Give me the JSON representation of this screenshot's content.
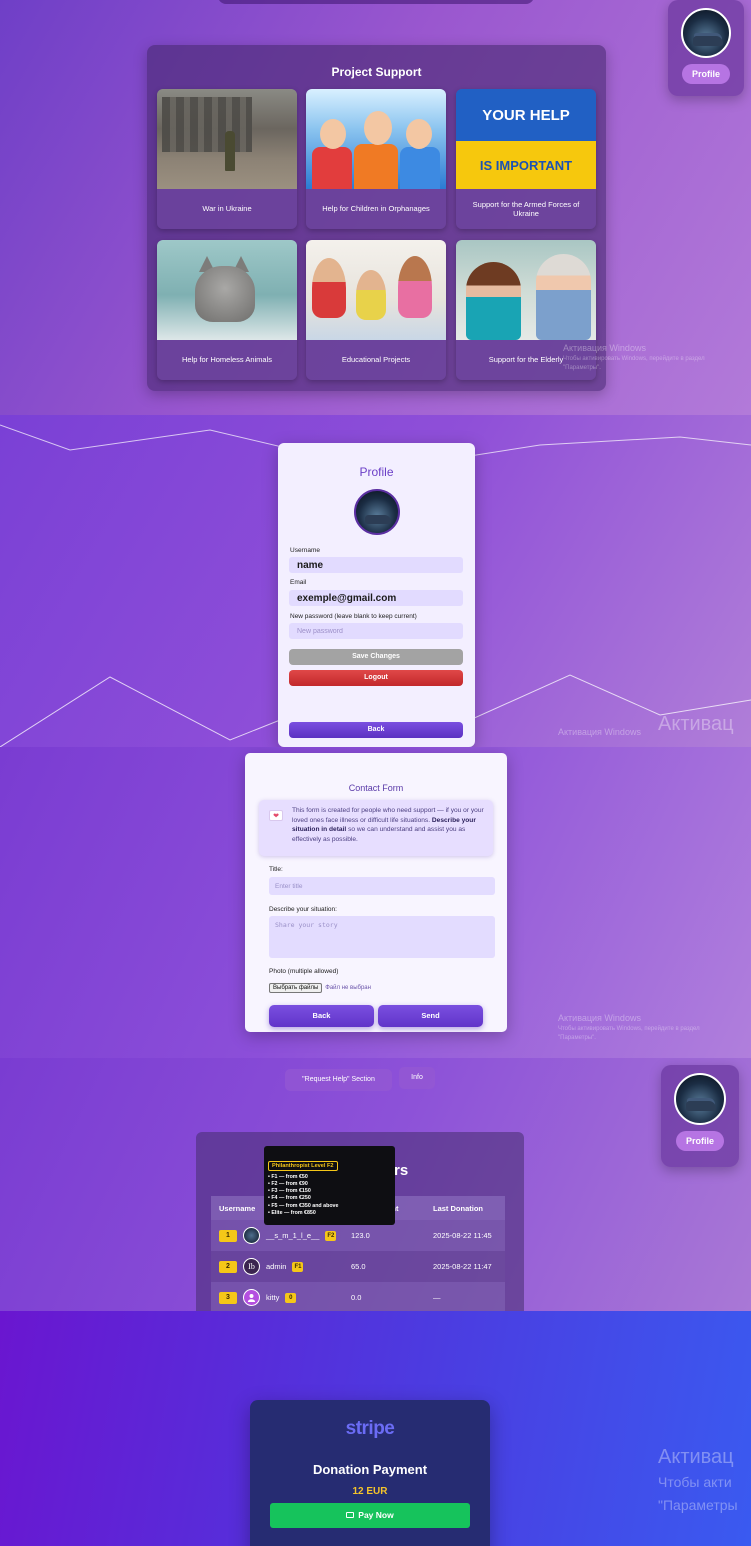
{
  "profile_widget": {
    "button_label": "Profile"
  },
  "project_support": {
    "title": "Project Support",
    "cards": [
      {
        "label": "War in Ukraine"
      },
      {
        "label": "Help for Children in Orphanages"
      },
      {
        "label": "Support for the Armed Forces of Ukraine",
        "image_text_1": "YOUR HELP",
        "image_text_2": "IS IMPORTANT"
      },
      {
        "label": "Help for Homeless Animals"
      },
      {
        "label": "Educational Projects"
      },
      {
        "label": "Support for the Elderly"
      }
    ]
  },
  "watermarks": {
    "activation_small": "Активация Windows",
    "activation_hint_1": "Чтобы активировать Windows, перейдите в раздел",
    "activation_hint_2": "\"Параметры\".",
    "activation_large": "Активац",
    "activation_large_hint_1": "Чтобы акти",
    "activation_large_hint_2": "\"Параметры"
  },
  "profile_form": {
    "title": "Profile",
    "username_label": "Username",
    "username_value": "name",
    "email_label": "Email",
    "email_value": "exemple@gmail.com",
    "password_label": "New password (leave blank to keep current)",
    "password_placeholder": "New password",
    "save_label": "Save Changes",
    "logout_label": "Logout",
    "back_label": "Back"
  },
  "contact_form": {
    "title": "Contact Form",
    "info_text_1": "This form is created for people who need support — if you or your loved ones face illness or difficult life situations.",
    "info_text_bold": "Describe your situation in detail",
    "info_text_2": "so we can understand and assist you as effectively as possible.",
    "title_label": "Title:",
    "title_placeholder": "Enter title",
    "describe_label": "Describe your situation:",
    "describe_placeholder": "Share your story",
    "photo_label": "Photo (multiple allowed)",
    "file_button": "Выбрать файлы",
    "file_status": "Файл не выбран",
    "back_label": "Back",
    "send_label": "Send"
  },
  "top_donators": {
    "request_help_button": "\"Request Help\" Section",
    "info_button": "Info",
    "title": "Top Donators",
    "columns": [
      "Username",
      "Total Amount",
      "Last Donation"
    ],
    "rows": [
      {
        "rank": "1",
        "username": "__s_m_1_l_e__",
        "level": "F2",
        "amount": "123.0",
        "last": "2025-08-22 11:45",
        "avatar": "car"
      },
      {
        "rank": "2",
        "username": "admin",
        "level": "F1",
        "amount": "65.0",
        "last": "2025-08-22 11:47",
        "avatar": "Ib"
      },
      {
        "rank": "3",
        "username": "kitty",
        "level": "0",
        "amount": "0.0",
        "last": "—",
        "avatar": "user"
      }
    ],
    "tooltip": {
      "title": "Philanthropist Level F2",
      "items": [
        "• F1 — from €50",
        "• F2 — from €90",
        "• F3 — from €150",
        "• F4 — from €250",
        "• F5 — from €350 and above",
        "• Elite — from €850"
      ]
    }
  },
  "stripe": {
    "logo": "stripe",
    "title": "Donation Payment",
    "amount": "12 EUR",
    "pay_label": "Pay Now"
  }
}
